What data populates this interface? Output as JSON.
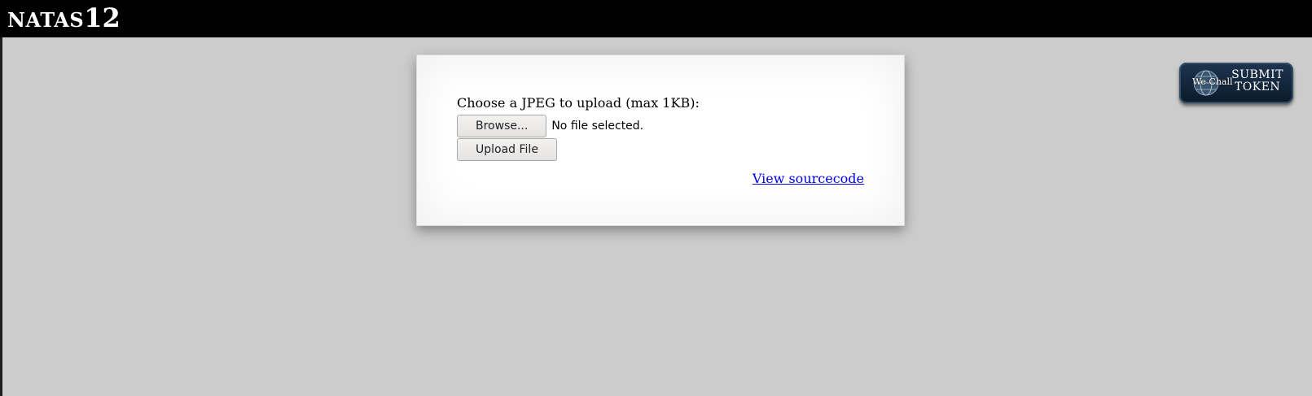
{
  "header": {
    "title_prefix": "NATAS",
    "title_level": "12"
  },
  "upload": {
    "prompt": "Choose a JPEG to upload (max 1KB):",
    "browse_label": "Browse...",
    "file_status": "No file selected.",
    "upload_label": "Upload File"
  },
  "links": {
    "view_source": "View sourcecode"
  },
  "token_button": {
    "logo_text": "We Chall",
    "line1": "SUBMIT",
    "line2": "TOKEN"
  },
  "colors": {
    "header_bg": "#000000",
    "page_bg": "#cccccc",
    "link": "#0000ee",
    "token_button_bg": "#13263b"
  }
}
